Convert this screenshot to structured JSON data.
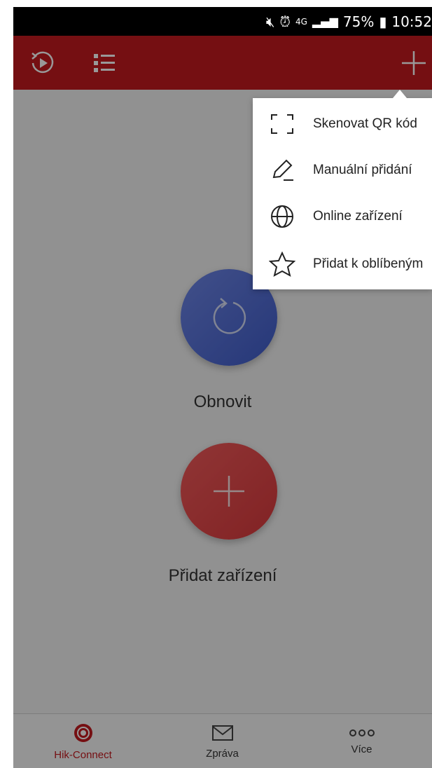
{
  "status_bar": {
    "network": "4G",
    "battery": "75%",
    "time": "10:52"
  },
  "app_bar": {
    "playback_icon": "playback-icon",
    "list_icon": "list-icon",
    "add_icon": "plus-icon"
  },
  "main": {
    "refresh_label": "Obnovit",
    "add_device_label": "Přidat zařízení"
  },
  "add_menu": {
    "items": [
      {
        "icon": "qr-scan-icon",
        "label": "Skenovat QR kód"
      },
      {
        "icon": "pencil-icon",
        "label": "Manuální přidání"
      },
      {
        "icon": "globe-icon",
        "label": "Online zařízení"
      },
      {
        "icon": "star-icon",
        "label": "Přidat k oblíbeným"
      }
    ]
  },
  "tabs": [
    {
      "label": "Hik-Connect",
      "icon": "hik-connect-icon",
      "active": true
    },
    {
      "label": "Zpráva",
      "icon": "envelope-icon",
      "active": false
    },
    {
      "label": "Více",
      "icon": "more-dots-icon",
      "active": false
    }
  ],
  "colors": {
    "brand_red": "#c41a1f",
    "refresh_blue": "#4e6bd6",
    "add_red": "#e24a4b"
  }
}
